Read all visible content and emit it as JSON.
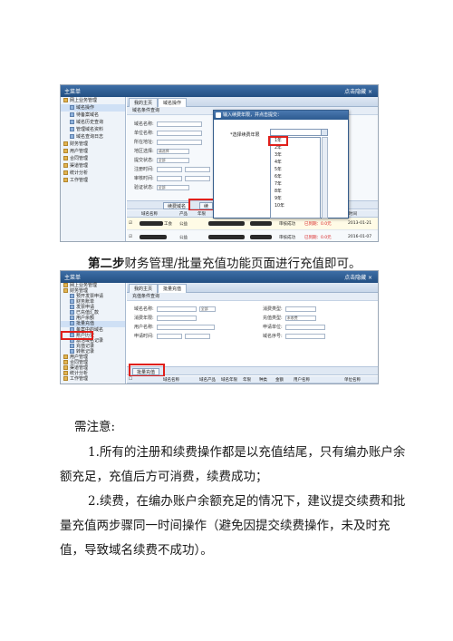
{
  "shot1": {
    "header_title": "主菜单",
    "header_right": "点击隐藏 ×",
    "tree": [
      "网上业务管理",
      "域名操作",
      "待备案域名",
      "域名历史查询",
      "管理域名资料",
      "域名查询日志",
      "财务管理",
      "用户管理",
      "合同管理",
      "渠道管理",
      "统计分析",
      "工作管理"
    ],
    "tabs": [
      "我的主页",
      "域名操作"
    ],
    "panel_header": "域名条件查询",
    "filters": [
      "域名名称:",
      "单位名称:",
      "所在地址:",
      "地区选择:",
      "提交状态:",
      "注册时间:",
      "审核时间:",
      "验证状态:"
    ],
    "filter_values": [
      "请选择",
      "全部",
      "全部"
    ],
    "buttons": [
      "续费域名",
      "续"
    ],
    "grid_headers": [
      "域名名称",
      "产品",
      "年限",
      "用户",
      "状态",
      "金额",
      "时间"
    ],
    "rows": [
      {
        "suffix": "工会",
        "product": "公益",
        "status": "审核成功",
        "flag": "已到期：0.0元",
        "date": "2013-01-21"
      },
      {
        "suffix": "",
        "product": "公益",
        "status": "审核成功",
        "flag": "已到期：0.0元",
        "date": "2016-01-07"
      }
    ],
    "dialog": {
      "title": "输入续费年限，并点击提交：",
      "label": "*选择续费年限",
      "options": [
        "1年",
        "2年",
        "3年",
        "4年",
        "5年",
        "6年",
        "7年",
        "8年",
        "9年",
        "10年"
      ],
      "selected": "1年"
    }
  },
  "step": {
    "bold": "第二步",
    "text": "财务管理/批量充值功能页面进行充值即可。"
  },
  "shot2": {
    "header_title": "主菜单",
    "header_right": "点击隐藏 ×",
    "tree": [
      "网上业务管理",
      "财务管理",
      "预开发票申请",
      "财务账单",
      "发票申请",
      "已充值汇款",
      "用户余额",
      "批量充值",
      "备案中的域名",
      "账户历史",
      "激活域名记录",
      "充值记录",
      "转账记录",
      "用户管理",
      "合同管理",
      "渠道管理",
      "统计分析",
      "工作管理"
    ],
    "selected_item": "批量充值",
    "tabs": [
      "我的主页",
      "批量充值"
    ],
    "panel_header": "充值条件查询",
    "filters_left": [
      "域名名称:",
      "消费年限:",
      "用户名称:",
      "申请时间:"
    ],
    "filters_right": [
      "消费类型:",
      "充值类型:",
      "申请单位:",
      "域名序号:"
    ],
    "filter_values": [
      "全部",
      "全部",
      "未收费"
    ],
    "button": "批量充值",
    "grid_headers": [
      "域名名称",
      "域名产品",
      "域名年限",
      "年限",
      "种类",
      "金额",
      "用户名称",
      "单位名称"
    ]
  },
  "notes": {
    "heading": "需注意:",
    "p1_line1": "1.所有的注册和续费操作都是以充值结尾，只有编办账户余",
    "p1_line2": "额充足，充值后方可消费，续费成功；",
    "p2_line1": "2.续费，在编办账户余额充足的情况下，建议提交续费和批",
    "p2_line2": "量充值两步骤同一时间操作（避免因提交续费操作，未及时充",
    "p2_line3": "值，导致域名续费不成功）。"
  },
  "colors": {
    "highlight": "#e0201b",
    "header": "#2c5a90"
  }
}
